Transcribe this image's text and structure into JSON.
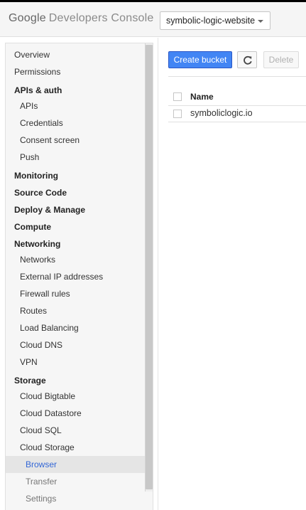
{
  "header": {
    "logo_google": "Google",
    "logo_product": "Developers Console",
    "project_name": "symbolic-logic-website"
  },
  "sidebar": {
    "items": [
      {
        "label": "Overview"
      },
      {
        "label": "Permissions"
      },
      {
        "label": "APIs & auth"
      },
      {
        "label": "APIs"
      },
      {
        "label": "Credentials"
      },
      {
        "label": "Consent screen"
      },
      {
        "label": "Push"
      },
      {
        "label": "Monitoring"
      },
      {
        "label": "Source Code"
      },
      {
        "label": "Deploy & Manage"
      },
      {
        "label": "Compute"
      },
      {
        "label": "Networking"
      },
      {
        "label": "Networks"
      },
      {
        "label": "External IP addresses"
      },
      {
        "label": "Firewall rules"
      },
      {
        "label": "Routes"
      },
      {
        "label": "Load Balancing"
      },
      {
        "label": "Cloud DNS"
      },
      {
        "label": "VPN"
      },
      {
        "label": "Storage"
      },
      {
        "label": "Cloud Bigtable"
      },
      {
        "label": "Cloud Datastore"
      },
      {
        "label": "Cloud SQL"
      },
      {
        "label": "Cloud Storage"
      },
      {
        "label": "Browser"
      },
      {
        "label": "Transfer"
      },
      {
        "label": "Settings"
      }
    ]
  },
  "toolbar": {
    "create_label": "Create bucket",
    "refresh_icon": "refresh-icon",
    "delete_label": "Delete"
  },
  "table": {
    "columns": [
      "Name"
    ],
    "rows": [
      {
        "name": "symboliclogic.io"
      }
    ]
  },
  "colors": {
    "accent": "#4285f4",
    "active_link": "#3367d6"
  }
}
